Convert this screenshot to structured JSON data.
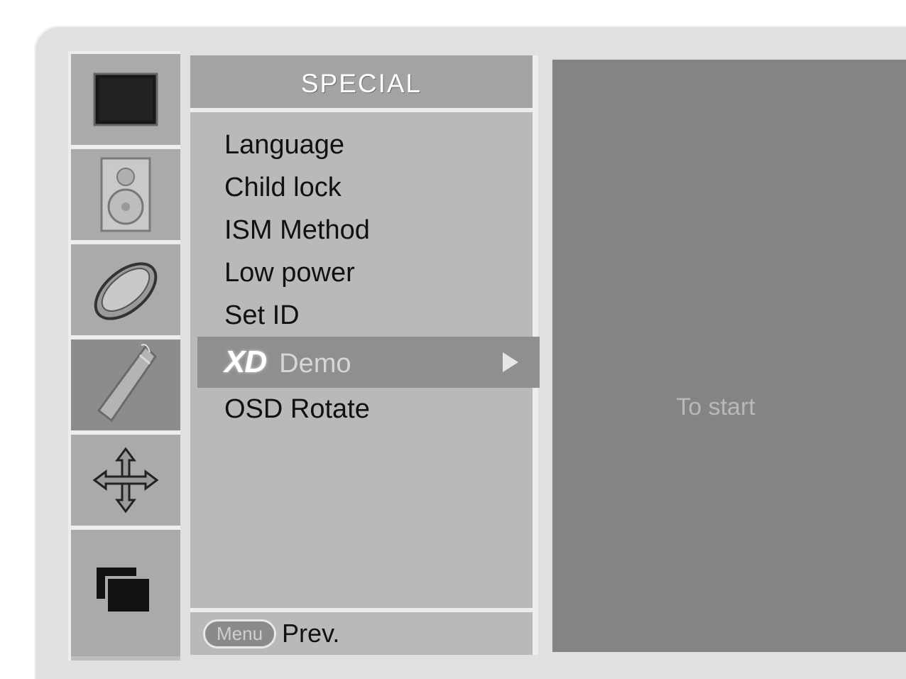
{
  "menu": {
    "title": "SPECIAL",
    "items": [
      {
        "label": "Language"
      },
      {
        "label": "Child lock"
      },
      {
        "label": "ISM Method"
      },
      {
        "label": "Low power"
      },
      {
        "label": "Set ID"
      },
      {
        "logo": "XD",
        "label": "Demo",
        "selected": true
      },
      {
        "label": "OSD Rotate"
      }
    ],
    "footer": {
      "button": "Menu",
      "label": "Prev."
    }
  },
  "side_icons": [
    {
      "name": "screen-icon"
    },
    {
      "name": "speaker-icon"
    },
    {
      "name": "disc-icon"
    },
    {
      "name": "remote-icon",
      "active": true
    },
    {
      "name": "arrows-icon"
    },
    {
      "name": "windows-icon"
    }
  ],
  "submenu": {
    "hint": "To start"
  },
  "colors": {
    "selected_bg": "#8f8f8f",
    "panel_bg": "#b9b9b9",
    "submenu_bg": "#848484"
  }
}
